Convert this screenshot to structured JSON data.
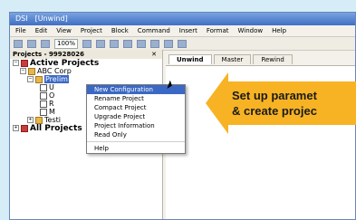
{
  "window": {
    "title_app": "DSI",
    "title_doc": "[Unwind]"
  },
  "menubar": [
    "File",
    "Edit",
    "View",
    "Project",
    "Block",
    "Command",
    "Insert",
    "Format",
    "Window",
    "Help"
  ],
  "toolbar": {
    "zoom": "100%"
  },
  "panel": {
    "title": "Projects - 99928026",
    "close": "✕"
  },
  "tree": {
    "active_projects": "Active Projects",
    "abc_corp": "ABC Corp",
    "selected": "Prelim",
    "item_u": "U",
    "item_o": "O",
    "item_r": "R",
    "item_m": "M",
    "testing": "Testi",
    "all_projects": "All Projects"
  },
  "tabs": [
    "Unwind",
    "Master",
    "Rewind"
  ],
  "context_menu": [
    "New Configuration",
    "Rename Project",
    "Compact Project",
    "Upgrade Project",
    "Project Information",
    "Read Only",
    "Help"
  ],
  "callout": {
    "line1": "Set up paramet",
    "line2": "& create projec",
    "color": "#f7b324"
  }
}
